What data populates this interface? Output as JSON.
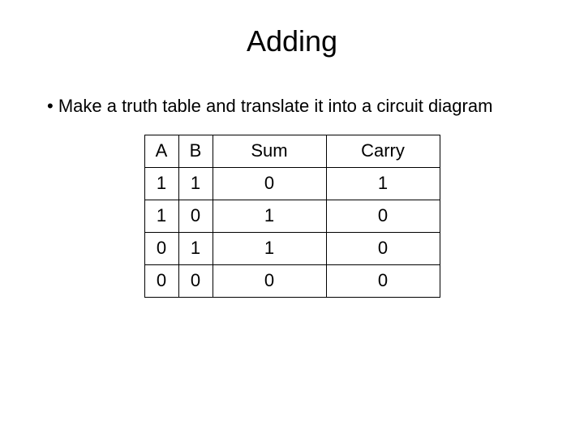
{
  "title": "Adding",
  "bullet": "• Make a truth table and translate it into a circuit diagram",
  "table": {
    "headers": [
      "A",
      "B",
      "Sum",
      "Carry"
    ],
    "rows": [
      [
        "1",
        "1",
        "0",
        "1"
      ],
      [
        "1",
        "0",
        "1",
        "0"
      ],
      [
        "0",
        "1",
        "1",
        "0"
      ],
      [
        "0",
        "0",
        "0",
        "0"
      ]
    ]
  }
}
